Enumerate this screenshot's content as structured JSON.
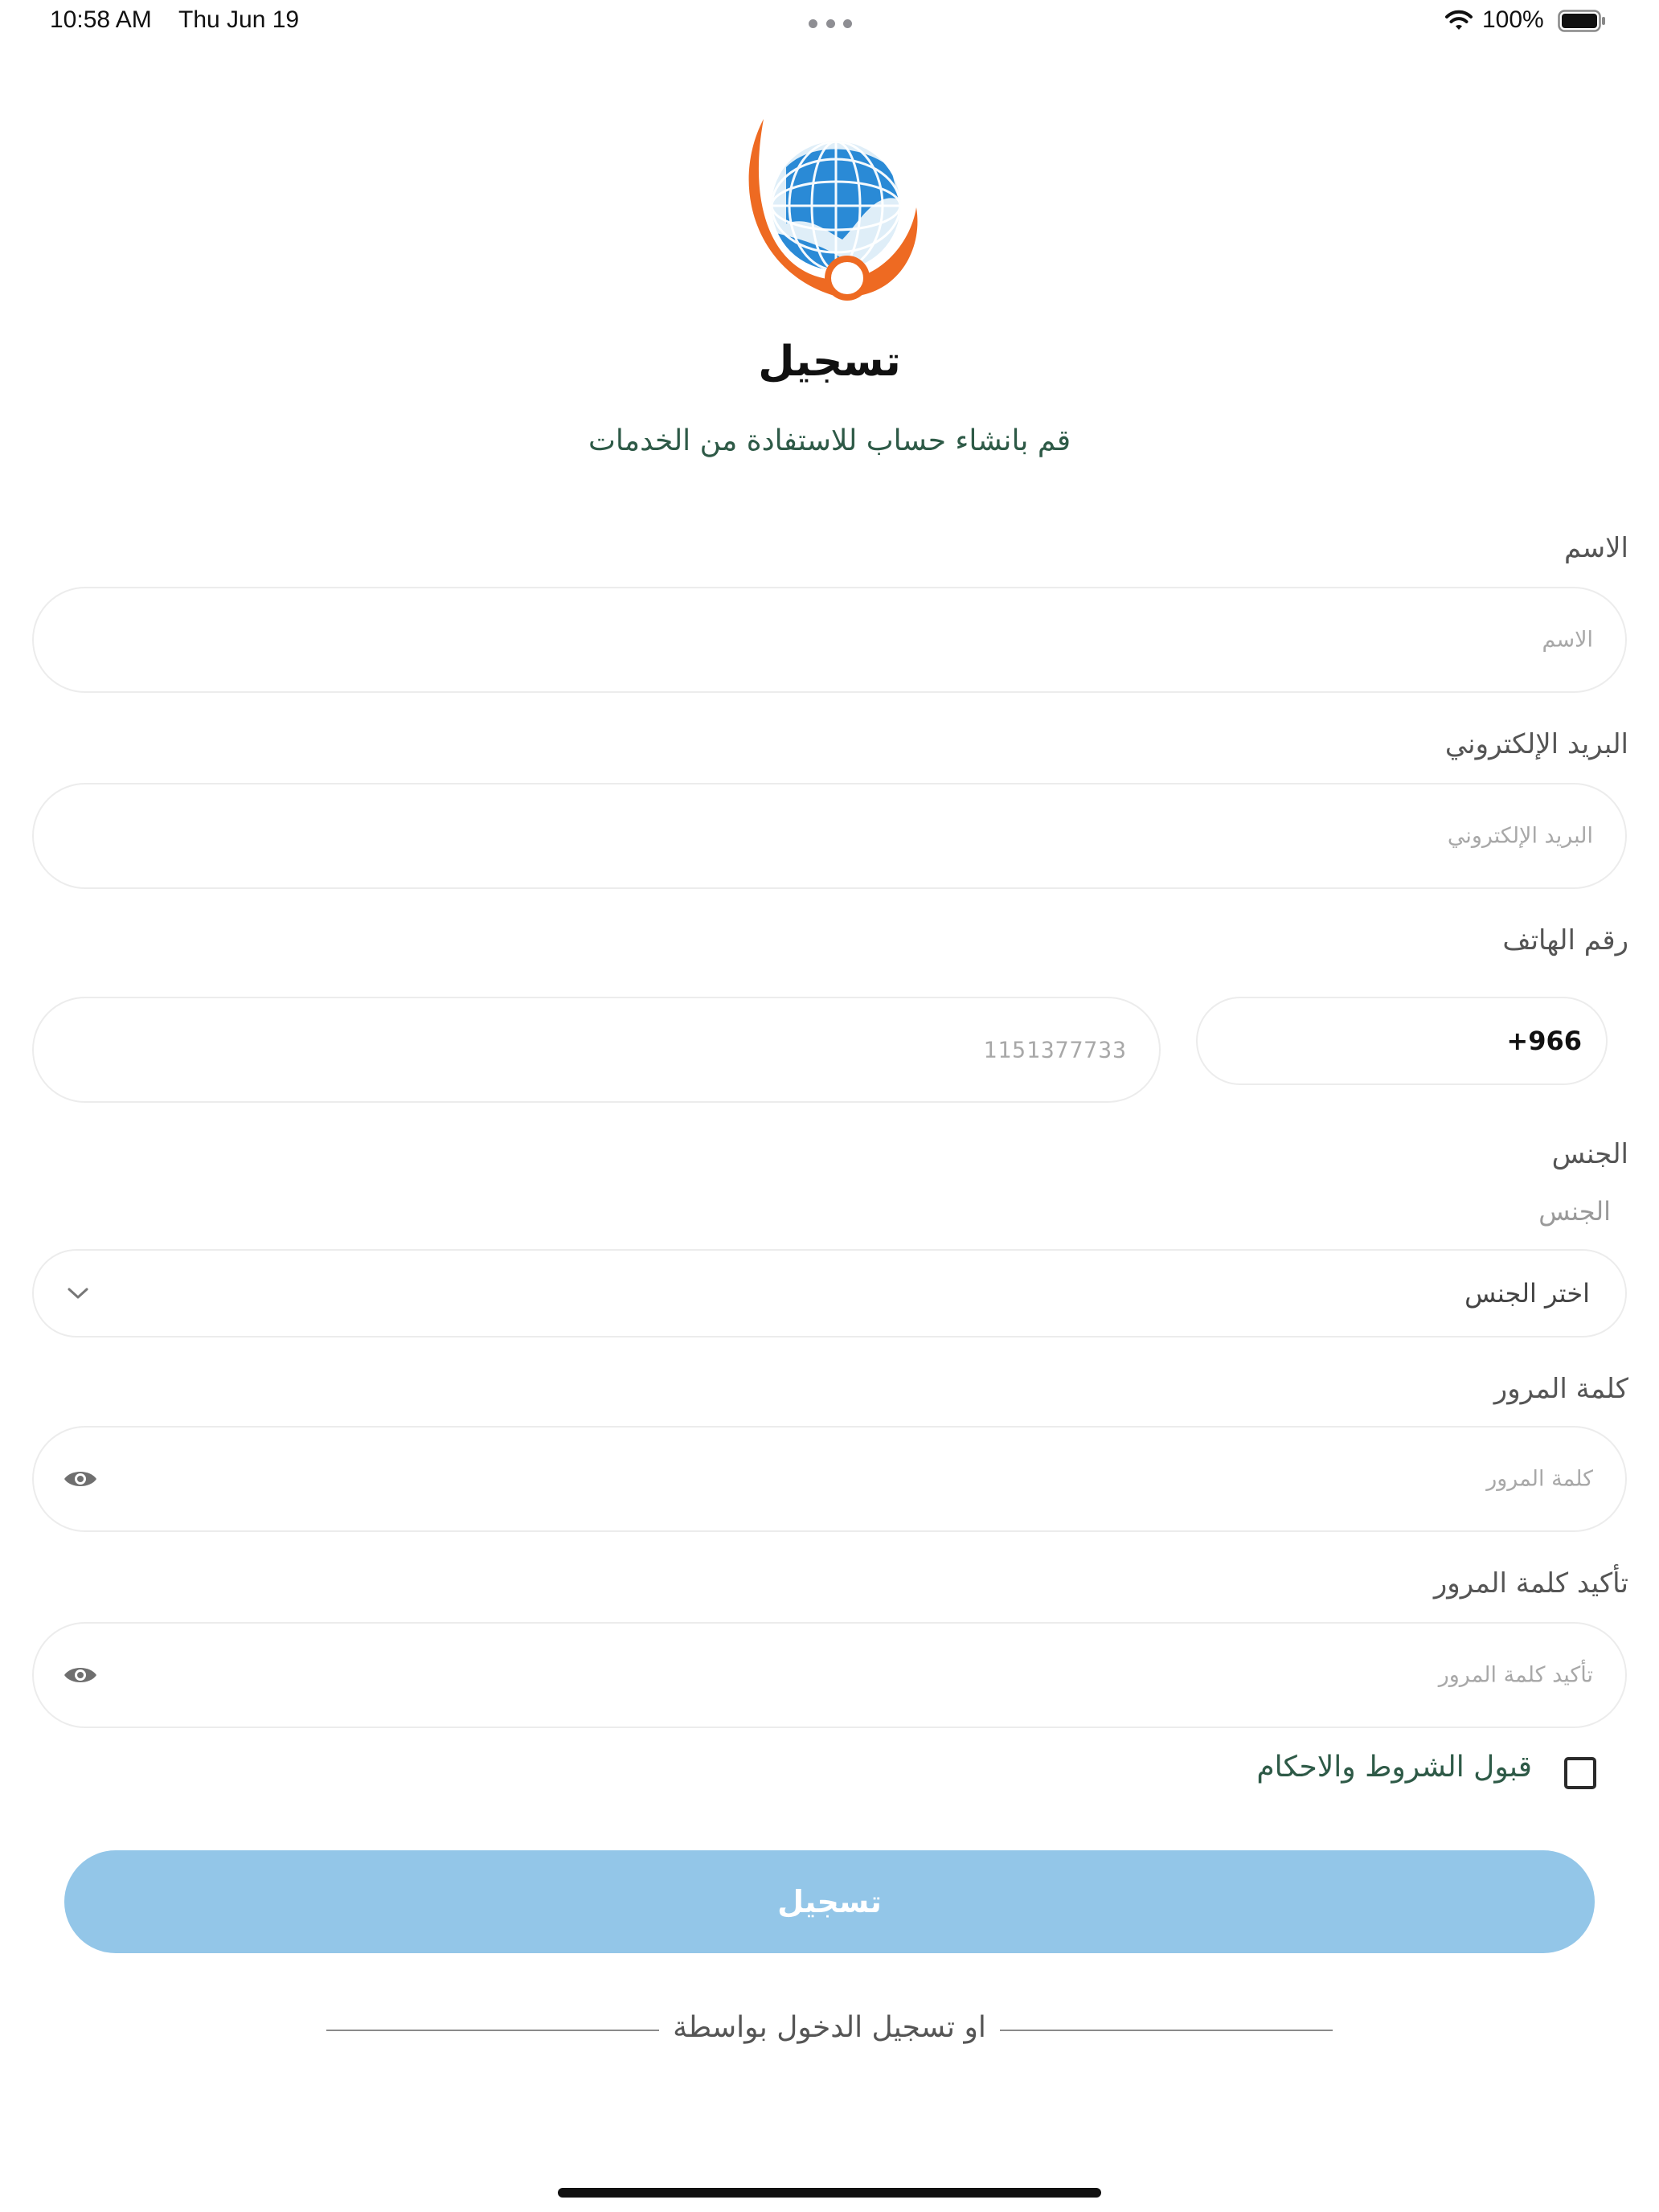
{
  "status_bar": {
    "time": "10:58 AM",
    "date": "Thu Jun 19",
    "battery_percent": "100%"
  },
  "header": {
    "title": "تسجيل",
    "subtitle": "قم بانشاء حساب للاستفادة من الخدمات"
  },
  "form": {
    "name": {
      "label": "الاسم",
      "placeholder": "الاسم"
    },
    "email": {
      "label": "البريد الإلكتروني",
      "placeholder": "البريد الإلكتروني"
    },
    "phone": {
      "label": "رقم الهاتف",
      "placeholder": "1151377733",
      "country_code": "966+"
    },
    "gender": {
      "label": "الجنس",
      "sub_label": "الجنس",
      "selected": "اختر الجنس"
    },
    "password": {
      "label": "كلمة المرور",
      "placeholder": "كلمة المرور"
    },
    "confirm_password": {
      "label": "تأكيد كلمة المرور",
      "placeholder": "تأكيد كلمة المرور"
    },
    "terms": {
      "label": "قبول الشروط والاحكام",
      "checked": false
    },
    "submit_label": "تسجيل",
    "submit_color": "#93c6e8"
  },
  "divider": {
    "text": "او تسجيل الدخول بواسطة"
  },
  "icons": {
    "dropdown": "chevron-down-icon",
    "password_visibility": "eye-icon",
    "wifi": "wifi-icon",
    "battery": "battery-icon"
  },
  "colors": {
    "accent_green": "#2e5a47",
    "logo_orange": "#ee6a22",
    "logo_blue": "#2a8ad6"
  }
}
